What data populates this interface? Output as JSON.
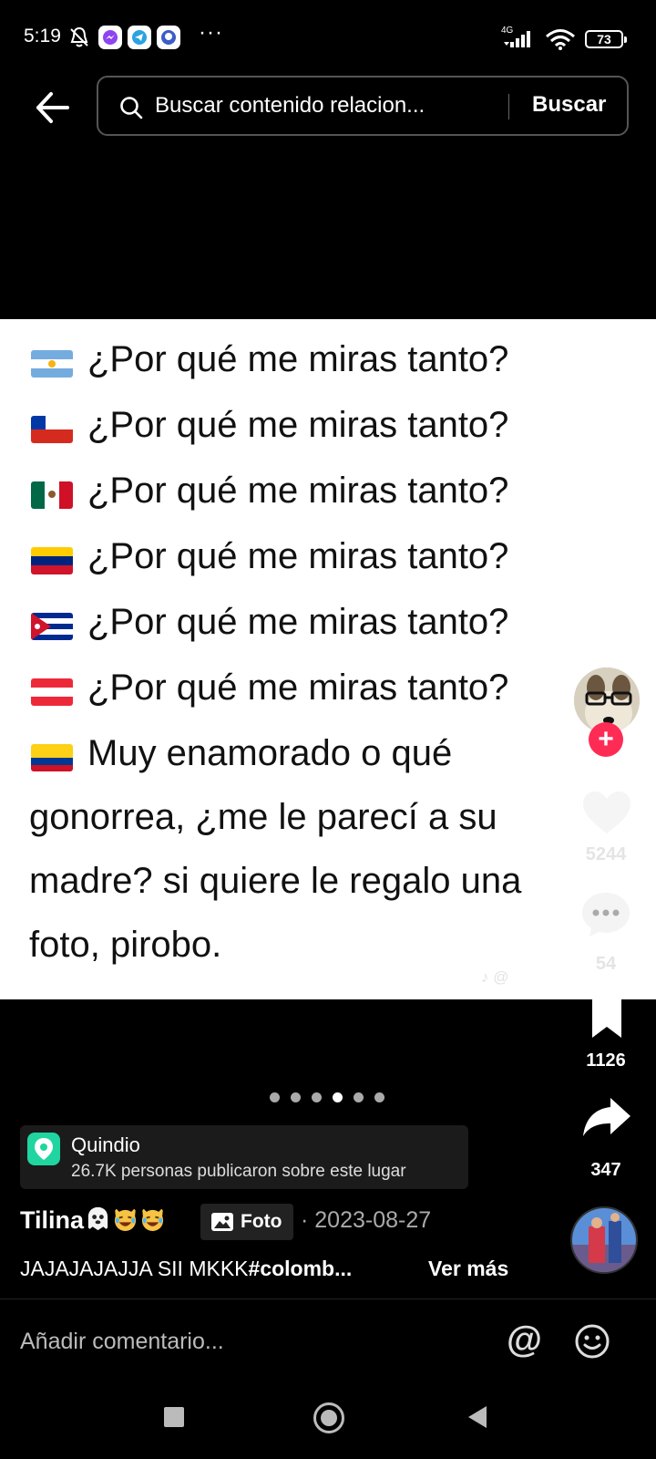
{
  "status_bar": {
    "time": "5:19",
    "more": "···",
    "network": "4G",
    "battery": "73"
  },
  "search": {
    "placeholder": "Buscar contenido relacion...",
    "button": "Buscar"
  },
  "post": {
    "lines": [
      {
        "flag": "argentina",
        "text": "¿Por qué me miras tanto?"
      },
      {
        "flag": "chile",
        "text": "¿Por qué me miras tanto?"
      },
      {
        "flag": "mexico",
        "text": "¿Por qué me miras tanto?"
      },
      {
        "flag": "venezuela",
        "text": "¿Por qué me miras tanto?"
      },
      {
        "flag": "cuba",
        "text": "¿Por qué me miras tanto?"
      },
      {
        "flag": "austria",
        "text": "¿Por qué me miras tanto?"
      },
      {
        "flag": "colombia",
        "text": "Muy enamorado o qué"
      }
    ],
    "continuation": [
      "gonorrea, ¿me le parecí a su",
      "madre? si quiere le regalo una",
      "foto, pirobo."
    ]
  },
  "actions": {
    "likes": "5244",
    "comments": "54",
    "saves": "1126",
    "shares": "347"
  },
  "pager": {
    "total": 6,
    "active": 4
  },
  "location": {
    "name": "Quindio",
    "subtitle": "26.7K personas publicaron sobre este lugar"
  },
  "author": {
    "name": "Tilina",
    "media_type": "Foto",
    "date": "· 2023-08-27"
  },
  "caption": {
    "text": "JAJAJAJAJJA SII MKKK",
    "hashtag": "#colomb...",
    "more": "Ver más"
  },
  "comment_bar": {
    "placeholder": "Añadir comentario...",
    "mention": "@"
  },
  "colors": {
    "like_red": "#fe2c55",
    "location_green": "#20d5a0"
  }
}
